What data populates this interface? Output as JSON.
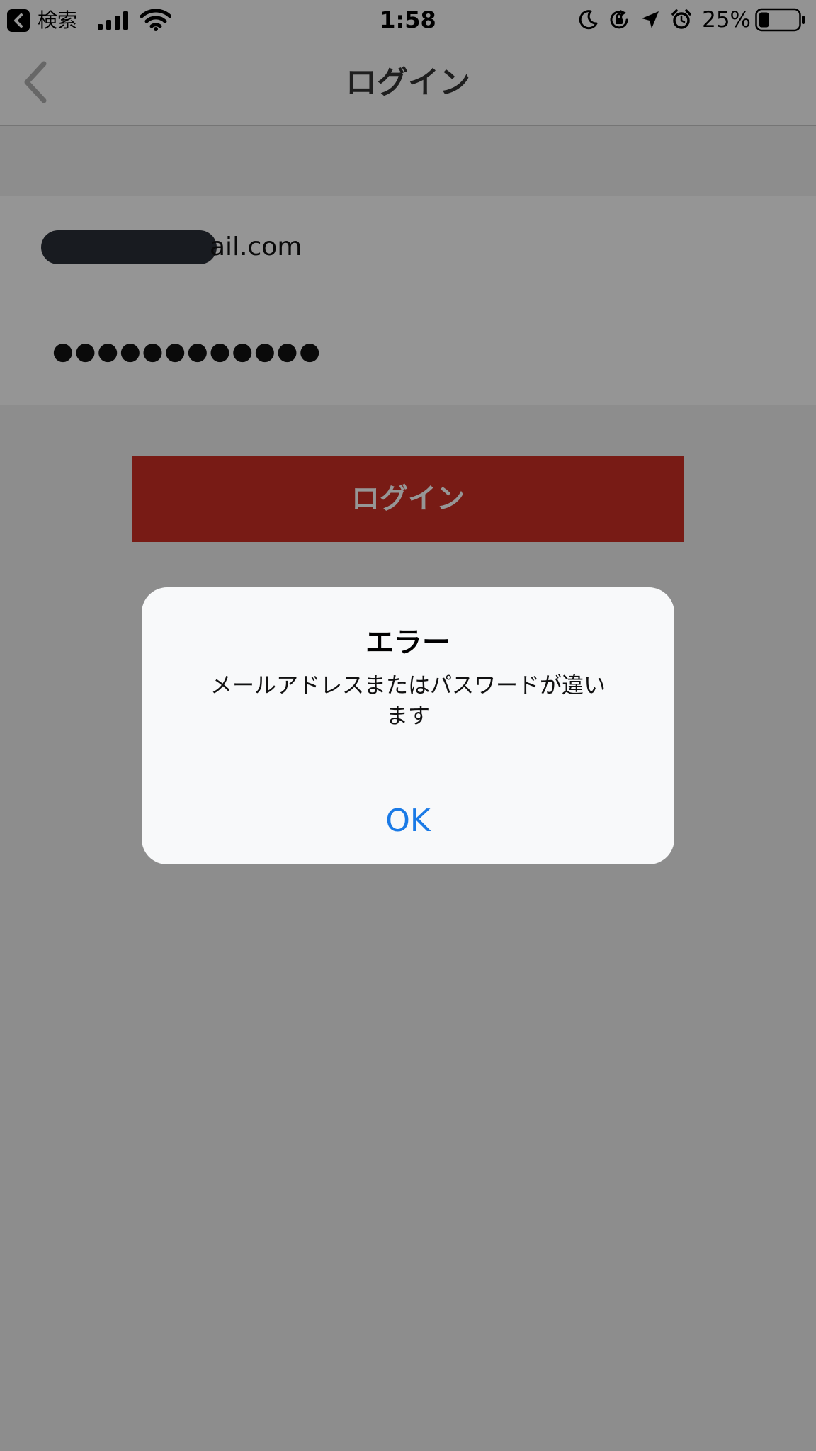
{
  "status_bar": {
    "back_app_label": "検索",
    "time": "1:58",
    "battery_percent": "25%",
    "battery_level": 0.25,
    "icons": [
      "back-app-icon",
      "cellular-signal-icon",
      "wifi-icon",
      "moon-icon",
      "orientation-lock-icon",
      "location-arrow-icon",
      "alarm-clock-icon",
      "battery-icon"
    ]
  },
  "nav": {
    "title": "ログイン",
    "back_icon": "chevron-left-icon"
  },
  "form": {
    "email_value_visible": "ail.com",
    "password_value": "●●●●●●●●●●●●"
  },
  "login_button": {
    "label": "ログイン",
    "color": "#cc2f25"
  },
  "alert": {
    "title": "エラー",
    "message_line1": "メールアドレスまたはパスワードが違い",
    "message_line2": "ます",
    "ok_label": "OK",
    "ok_color": "#1a7ae6"
  }
}
